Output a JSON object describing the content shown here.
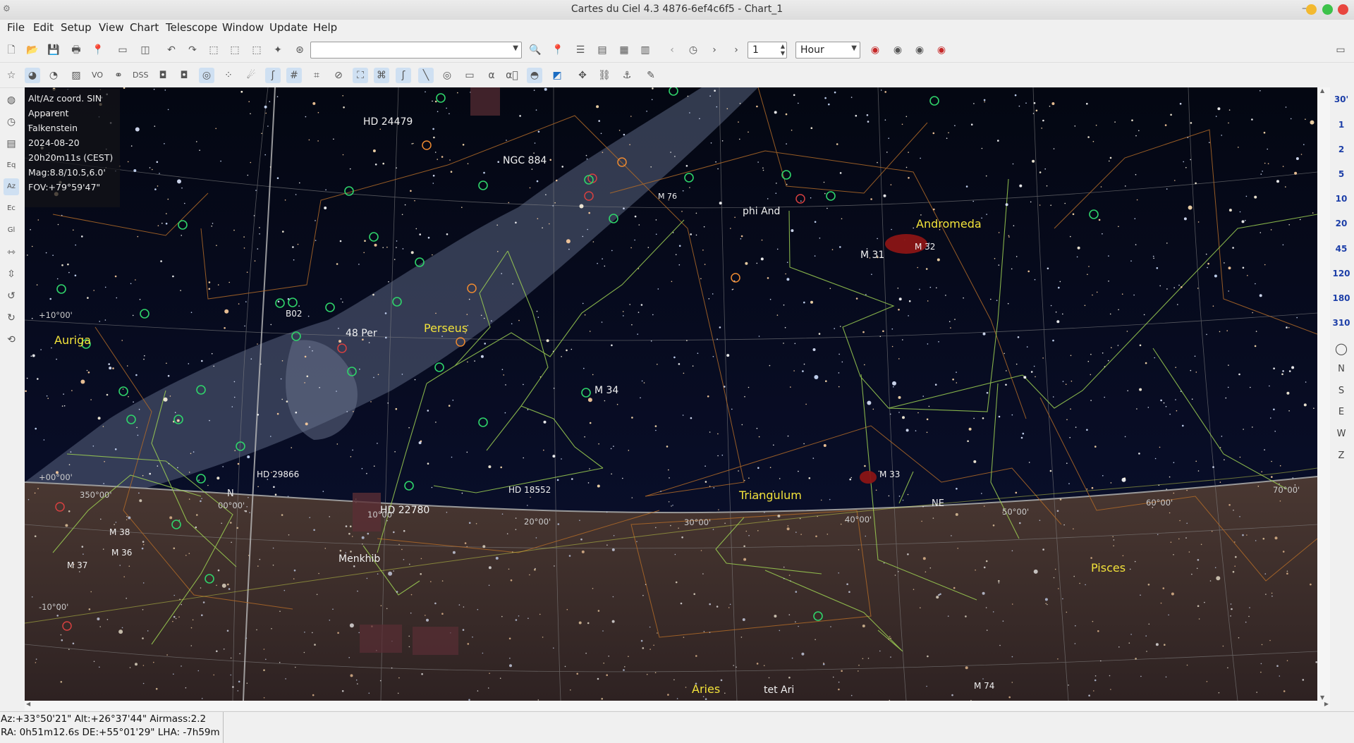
{
  "window": {
    "title": "Cartes du Ciel 4.3 4876-6ef4c6f5 - Chart_1"
  },
  "menu": [
    "File",
    "Edit",
    "Setup",
    "View",
    "Chart",
    "Telescope",
    "Window",
    "Update",
    "Help"
  ],
  "toolbar": {
    "search_value": "",
    "step_value": "1",
    "time_unit": "Hour"
  },
  "info": {
    "projection": "Alt/Az coord. SIN",
    "position_type": "Apparent",
    "location": "Falkenstein",
    "date": "2024-08-20",
    "time": "20h20m11s (CEST)",
    "magnitude": "Mag:8.8/10.5,6.0'",
    "fov": "FOV:+79°59'47\""
  },
  "zoom_levels": [
    "30'",
    "1",
    "2",
    "5",
    "10",
    "20",
    "45",
    "120",
    "180",
    "310"
  ],
  "directions": [
    "N",
    "S",
    "E",
    "W",
    "Z"
  ],
  "status": {
    "line1": "Az:+33°50'21\" Alt:+26°37'44\" Airmass:2.2",
    "line2": "RA:  0h51m12.6s DE:+55°01'29\" LHA: -7h59m"
  },
  "chart": {
    "constellations": [
      "Perseus",
      "Andromeda",
      "Triangulum",
      "Auriga",
      "Pisces",
      "Aries"
    ],
    "objects": [
      "HD 24479",
      "NGC 884",
      "phi And",
      "M 31",
      "M 32",
      "M 76",
      "48 Per",
      "M 34",
      "M 33",
      "HD 29866",
      "HD 22780",
      "HD 18552",
      "Menkhib",
      "B02",
      "tet Ari",
      "M 38",
      "M 36",
      "M 37",
      "M 74"
    ],
    "horizon_labels": [
      "NE",
      "N"
    ],
    "coordinate_labels": [
      "+10°00'",
      "+00°00'",
      "-10°00'",
      "350°00'",
      "10°00'",
      "20°00'",
      "30°00'",
      "40°00'",
      "50°00'",
      "60°00'",
      "70°00'",
      "00°00'"
    ]
  }
}
